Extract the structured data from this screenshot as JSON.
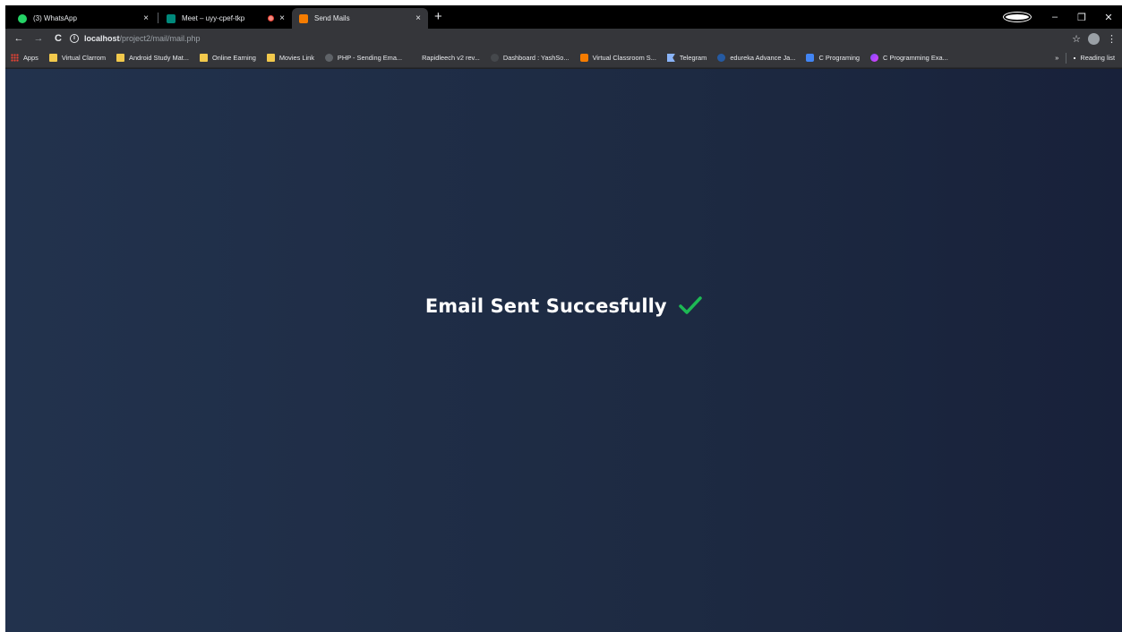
{
  "tabs": [
    {
      "title": "(3) WhatsApp",
      "close": "×",
      "icon": "whatsapp-icon",
      "color": "#25d366"
    },
    {
      "title": "Meet – uyy-cpef-tkp",
      "close": "×",
      "icon": "google-meet-icon",
      "color": "#00897b"
    },
    {
      "title": "Send Mails",
      "close": "×",
      "icon": "mail-icon",
      "color": "#f57c00"
    }
  ],
  "new_tab": "+",
  "window_controls": {
    "minimize": "–",
    "restore": "❐",
    "close": "✕"
  },
  "toolbar": {
    "back": "←",
    "forward": "→",
    "reload": "C",
    "url_host": "localhost",
    "url_path": "/project2/mail/mail.php",
    "bookmark_star": "☆",
    "menu": "⋮"
  },
  "bookmarks": [
    {
      "label": "Apps",
      "icon": "apps-icon"
    },
    {
      "label": "Virtual Clarrom",
      "icon": "folder-icon"
    },
    {
      "label": "Android Study Mat...",
      "icon": "folder-icon"
    },
    {
      "label": "Online Earning",
      "icon": "folder-icon"
    },
    {
      "label": "Movies Link",
      "icon": "folder-icon"
    },
    {
      "label": "PHP - Sending Ema...",
      "icon": "globe-icon"
    },
    {
      "label": "Rapidleech v2 rev...",
      "icon": "none"
    },
    {
      "label": "Dashboard : YashSo...",
      "icon": "dashboard-icon"
    },
    {
      "label": "Virtual Classroom S...",
      "icon": "classroom-icon"
    },
    {
      "label": "Telegram",
      "icon": "flag-icon"
    },
    {
      "label": "edureka Advance Ja...",
      "icon": "edureka-icon"
    },
    {
      "label": "C Programing",
      "icon": "bookmark-blue-icon"
    },
    {
      "label": "C Programming Exa...",
      "icon": "c-programming-icon"
    }
  ],
  "bookmarks_overflow": "»",
  "reading_list": "Reading list",
  "page": {
    "message": "Email Sent Succesfully",
    "accent": "#1db954"
  }
}
